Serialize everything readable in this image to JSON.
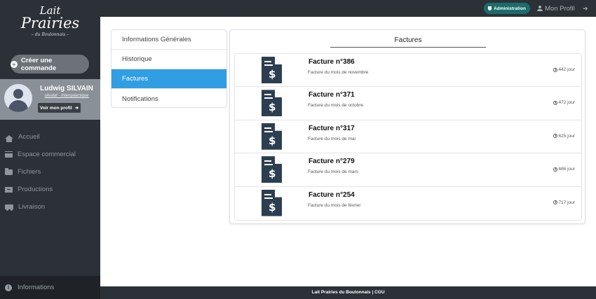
{
  "brand": {
    "line1": "Lait",
    "line2": "Prairies",
    "line3": "– du Boulonnais –"
  },
  "sidebar": {
    "create_order_label": "Créer une commande",
    "profile": {
      "name": "Ludwig SILVAIN",
      "role": "silvalaf - Intergalactique",
      "view_profile_label": "Voir mon profil"
    },
    "nav": [
      {
        "label": "Accueil",
        "icon": "home-icon"
      },
      {
        "label": "Espace commercial",
        "icon": "store-icon"
      },
      {
        "label": "Fichiers",
        "icon": "folder-icon"
      },
      {
        "label": "Productions",
        "icon": "box-icon"
      },
      {
        "label": "Livraison",
        "icon": "truck-icon"
      }
    ],
    "info_label": "Informations"
  },
  "topbar": {
    "admin_label": "Administration",
    "profile_label": "Mon Profil",
    "logout_icon": "sign-out-icon"
  },
  "menu": {
    "items": [
      "Informations Générales",
      "Historique",
      "Factures",
      "Notifications"
    ],
    "active": "Factures"
  },
  "invoices": {
    "title": "Factures",
    "items": [
      {
        "title": "Facture n°386",
        "desc": "Facture du mois de novembre",
        "days": "442 jour"
      },
      {
        "title": "Facture n°371",
        "desc": "Facture du mois de octobre",
        "days": "472 jour"
      },
      {
        "title": "Facture n°317",
        "desc": "Facture du mois de mai",
        "days": "625 jour"
      },
      {
        "title": "Facture n°279",
        "desc": "Facture du mois de mars",
        "days": "686 jour"
      },
      {
        "title": "Facture n°254",
        "desc": "Facture du mois de février",
        "days": "717 jour"
      }
    ]
  },
  "footer": {
    "text": "Lait Prairies du Boulonnais | CGU"
  },
  "colors": {
    "sidebar": "#2c3138",
    "active_tab": "#2f9ee2",
    "admin_button": "#1b6d6a",
    "invoice_icon": "#2c3e50"
  }
}
